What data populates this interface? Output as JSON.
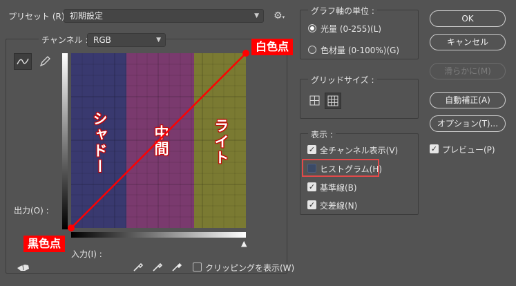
{
  "preset": {
    "label": "プリセット (R) :",
    "value": "初期設定"
  },
  "channel": {
    "label": "チャンネル :",
    "value": "RGB"
  },
  "curve": {
    "output_label": "出力(O) :",
    "input_label": "入力(I) :",
    "zones": {
      "shadow": "シャドー",
      "mid": "中間",
      "light": "ライト"
    },
    "callouts": {
      "white_point": "白色点",
      "black_point": "黒色点"
    },
    "zone_colors": {
      "shadow": "#39396f",
      "mid": "#7a3a6e",
      "light": "#7a7a32"
    },
    "line_color": "#ff0000"
  },
  "clip_label": "クリッピングを表示(W)",
  "axis_group": {
    "title": "グラフ軸の単位 :",
    "options": [
      {
        "label": "光量 (0-255)(L)",
        "selected": true
      },
      {
        "label": "色材量 (0-100%)(G)",
        "selected": false
      }
    ]
  },
  "grid_group": {
    "title": "グリッドサイズ :"
  },
  "display_group": {
    "title": "表示 :",
    "items": [
      {
        "label": "全チャンネル表示(V)",
        "checked": true
      },
      {
        "label": "ヒストグラム(H)",
        "checked": false
      },
      {
        "label": "基準線(B)",
        "checked": true
      },
      {
        "label": "交差線(N)",
        "checked": true
      }
    ]
  },
  "buttons": {
    "ok": "OK",
    "cancel": "キャンセル",
    "smooth": "滑らかに(M)",
    "auto": "自動補正(A)",
    "options": "オプション(T)..."
  },
  "preview": {
    "label": "プレビュー(P)",
    "checked": true
  },
  "highlight_color": "#e24a4a"
}
